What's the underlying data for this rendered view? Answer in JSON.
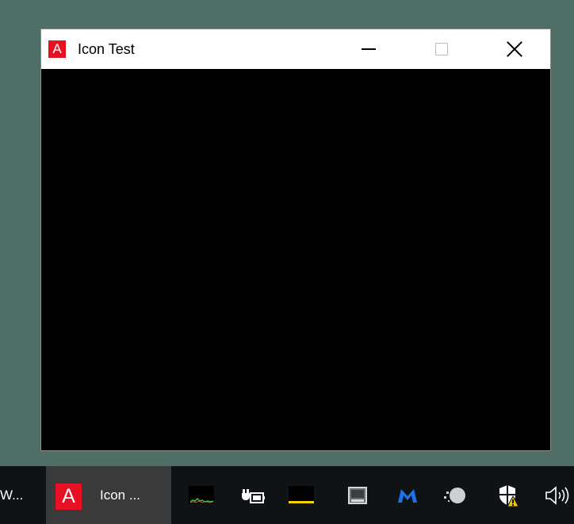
{
  "desktop": {
    "background_color": "#4f6f66"
  },
  "window": {
    "title": "Icon Test",
    "app_icon_glyph": "A",
    "app_icon_color": "#e81123",
    "client_color": "#000000",
    "controls": {
      "minimize_icon": "minimize-icon",
      "maximize_icon": "maximize-icon",
      "close_icon": "close-icon"
    }
  },
  "taskbar": {
    "background_color": "#101315",
    "previous_item_label": "W...",
    "active_app": {
      "label": "Icon ...",
      "icon_glyph": "A"
    },
    "tray_icons": [
      "cpu-monitor-icon",
      "power-plug-icon",
      "disk-monitor-icon",
      "tablet-mode-icon",
      "malwarebytes-icon",
      "cloud-sync-icon",
      "security-warning-icon",
      "volume-icon"
    ]
  }
}
